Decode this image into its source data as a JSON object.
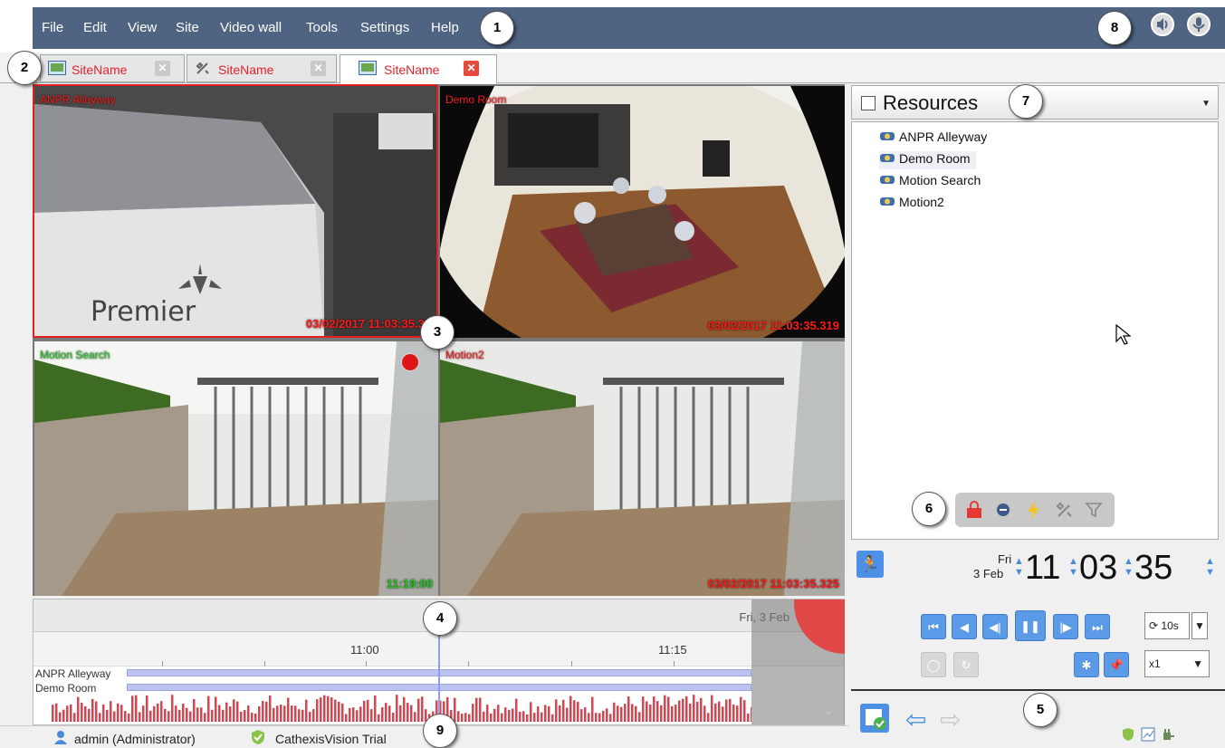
{
  "menu": {
    "items": [
      "File",
      "Edit",
      "View",
      "Site",
      "Video wall",
      "Tools",
      "Settings",
      "Help"
    ],
    "bar_color": "#4f6482"
  },
  "callouts": [
    "1",
    "2",
    "3",
    "4",
    "5",
    "6",
    "7",
    "8",
    "9"
  ],
  "tabs": [
    {
      "label": "SiteName",
      "icon": "monitor-icon",
      "active": false
    },
    {
      "label": "SiteName",
      "icon": "tools-icon",
      "active": false
    },
    {
      "label": "SiteName",
      "icon": "monitor-icon",
      "active": true
    }
  ],
  "cameras": [
    {
      "name": "ANPR Alleyway",
      "timestamp": "03/02/2017 11:03:35.37",
      "watermark": "Premier",
      "selected": true
    },
    {
      "name": "Demo Room",
      "timestamp": "03/02/2017 11:03:35.319",
      "selected": false
    },
    {
      "name": "Motion Search",
      "timestamp": "11:19:00",
      "recording": true,
      "selected": false
    },
    {
      "name": "Motion2",
      "timestamp": "03/02/2017 11:03:35.325",
      "selected": false
    }
  ],
  "timeline": {
    "day_label": "Fri, 3 Feb",
    "hour_labels": [
      "11:00",
      "11:15"
    ],
    "tracks": [
      "ANPR Alleyway",
      "Demo Room"
    ],
    "motion_color": "#e0414b"
  },
  "status": {
    "user": "admin (Administrator)",
    "license": "CathexisVision Trial"
  },
  "resources": {
    "title": "Resources",
    "items": [
      "ANPR Alleyway",
      "Demo Room",
      "Motion Search",
      "Motion2"
    ],
    "selected_index": 1,
    "filter_icons": [
      "lock-icon",
      "minus-circle-icon",
      "lightning-icon",
      "tools-icon",
      "filter-icon"
    ]
  },
  "clock": {
    "weekday": "Fri",
    "date": "3 Feb",
    "hours": "11",
    "minutes": "03",
    "seconds": "35"
  },
  "playback": {
    "skip_label": "10s",
    "speed_label": "x1"
  }
}
